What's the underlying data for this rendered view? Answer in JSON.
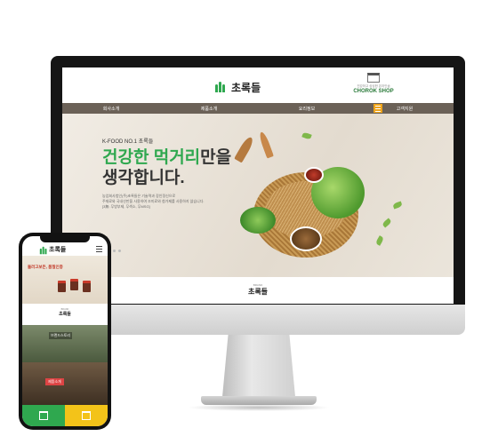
{
  "desktop": {
    "logo_text": "초록들",
    "shop": {
      "sub": "건강하고 싱싱한 온라인숍",
      "name": "CHOROK SHOP"
    },
    "nav": [
      "회사소개",
      "제품소개",
      "요리정보",
      "고객지원"
    ],
    "hero": {
      "tag": "K-FOOD NO.1 초록들",
      "title_line1_green": "건강한 먹거리",
      "title_line1_rest": "만을",
      "title_line2": "생각합니다.",
      "desc_line1": "농업회사법인(주)초록들은 기술력과 장인정신으로",
      "desc_line2": "주재료와 국내산만을 사용하여 조미료와 첨가제를 사용하지 않습니다.",
      "desc_line3": "[3無: 무방부제, 무색소, 무MSG]"
    },
    "brand": {
      "sub": "BRAND",
      "name": "초록들"
    }
  },
  "mobile": {
    "logo_text": "초록들",
    "hero_text": "둘러고보든, 품질인증",
    "brand_name": "초록들",
    "section1_label": "브랜드스토리",
    "section2_label": "제품소개"
  },
  "colors": {
    "brand_green": "#2fa84f",
    "nav_brown": "#6b6157",
    "accent_orange": "#f0a51a",
    "mobile_yellow": "#f3c319"
  }
}
